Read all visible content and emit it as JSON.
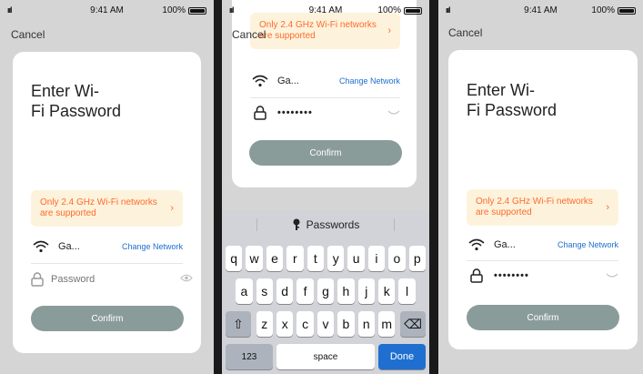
{
  "status": {
    "signal": "ııl",
    "time": "9:41 AM",
    "battery": "100%"
  },
  "cancel_label": "Cancel",
  "title": "Enter Wi-Fi Password",
  "title_line1": "Enter Wi-",
  "title_line2": "Fi Password",
  "warning": {
    "text": "Only 2.4 GHz Wi-Fi networks are supported",
    "chevron": "›"
  },
  "network": {
    "name": "Ga...",
    "change_label": "Change Network"
  },
  "password": {
    "placeholder": "Password",
    "masked": "••••••••"
  },
  "confirm_label": "Confirm",
  "keyboard": {
    "bar_label": "Passwords",
    "row1": [
      "q",
      "w",
      "e",
      "r",
      "t",
      "y",
      "u",
      "i",
      "o",
      "p"
    ],
    "row2": [
      "a",
      "s",
      "d",
      "f",
      "g",
      "h",
      "j",
      "k",
      "l"
    ],
    "row3": [
      "z",
      "x",
      "c",
      "v",
      "b",
      "n",
      "m"
    ],
    "shift": "⇧",
    "delete": "⌫",
    "numbers": "123",
    "space": "space",
    "done": "Done"
  },
  "icons": {
    "wifi": "wifi-icon",
    "lock": "lock-icon",
    "eye": "eye-icon",
    "key": "key-icon"
  },
  "colors": {
    "warning_text": "#ff6a2c",
    "warning_bg": "#fdf3dc",
    "link": "#1e6fd0",
    "button": "#8a9c9a",
    "done": "#1e6fd0"
  }
}
